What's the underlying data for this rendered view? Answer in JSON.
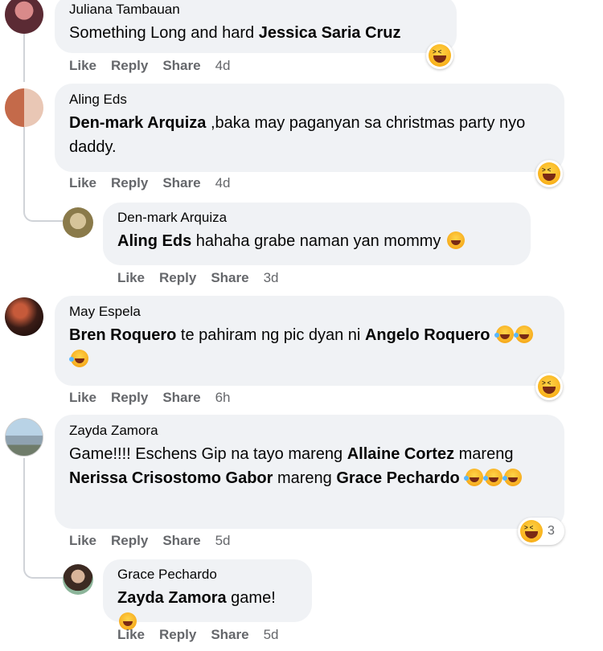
{
  "comments": [
    {
      "author": "Juliana Tambauan",
      "text_plain": "Something Long and hard ",
      "mention": "Jessica Saria Cruz",
      "actions": {
        "like": "Like",
        "reply": "Reply",
        "share": "Share",
        "time": "4d"
      },
      "reaction_icon": "laughing-emoji-icon"
    },
    {
      "author": "Aling Eds",
      "mention": "Den-mark Arquiza",
      "text_plain": " ,baka may paganyan sa christmas party nyo daddy.",
      "actions": {
        "like": "Like",
        "reply": "Reply",
        "share": "Share",
        "time": "4d"
      },
      "reaction_icon": "laughing-emoji-icon"
    },
    {
      "author": "Den-mark Arquiza",
      "mention": "Aling Eds",
      "text_plain": " hahaha grabe naman yan mommy",
      "inline_emoji": "grinning-sweat-emoji-icon",
      "actions": {
        "like": "Like",
        "reply": "Reply",
        "share": "Share",
        "time": "3d"
      }
    },
    {
      "author": "May Espela",
      "mention1": "Bren Roquero",
      "text_plain": " te pahiram ng pic dyan ni ",
      "mention2": "Angelo Roquero",
      "inline_emoji": "rolling-laughing-emoji-icon",
      "actions": {
        "like": "Like",
        "reply": "Reply",
        "share": "Share",
        "time": "6h"
      },
      "reaction_icon": "laughing-emoji-icon"
    },
    {
      "author": "Zayda Zamora",
      "text_plain1": "Game!!!! Eschens Gip na tayo mareng ",
      "mention1": "Allaine Cortez",
      "text_plain2": " mareng ",
      "mention2": "Nerissa Crisostomo Gabor",
      "text_plain3": " mareng ",
      "mention3": "Grace Pechardo",
      "inline_emoji": "rolling-laughing-emoji-icon",
      "actions": {
        "like": "Like",
        "reply": "Reply",
        "share": "Share",
        "time": "5d"
      },
      "reaction_icon": "laughing-emoji-icon",
      "reaction_count": "3"
    },
    {
      "author": "Grace Pechardo",
      "mention": "Zayda Zamora",
      "text_plain": " game!",
      "inline_emoji": "laughing-emoji-icon",
      "actions": {
        "like": "Like",
        "reply": "Reply",
        "share": "Share",
        "time": "5d"
      }
    }
  ],
  "colors": {
    "bubble": "#f0f2f5",
    "secondary_text": "#65676b",
    "thread_line": "#d0d3d8"
  }
}
